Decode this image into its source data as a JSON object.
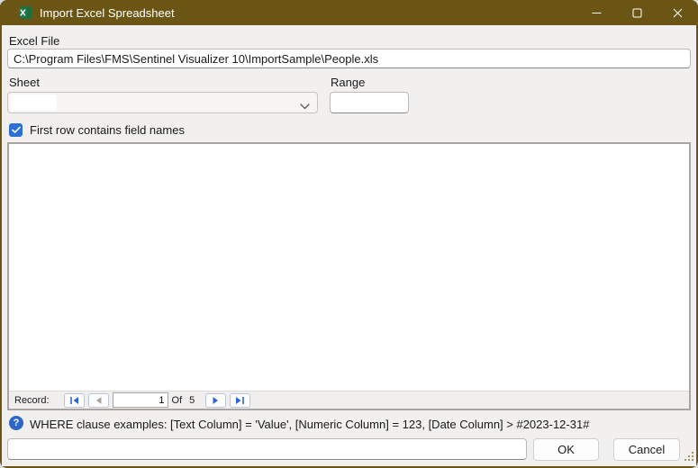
{
  "window": {
    "title": "Import Excel Spreadsheet"
  },
  "form": {
    "excel_file": {
      "label": "Excel File",
      "value": "C:\\Program Files\\FMS\\Sentinel Visualizer 10\\ImportSample\\People.xls"
    },
    "sheet": {
      "label": "Sheet",
      "value": ""
    },
    "range": {
      "label": "Range",
      "value": ""
    },
    "first_row_checkbox": {
      "label": "First row contains field names",
      "checked": true
    }
  },
  "record_nav": {
    "label": "Record:",
    "current": "1",
    "of": "Of",
    "total": "5"
  },
  "help": {
    "glyph": "?",
    "text": "WHERE clause examples: [Text Column] = 'Value', [Numeric Column] = 123, [Date Column] > #2023-12-31#"
  },
  "where_input": {
    "value": ""
  },
  "actions": {
    "ok": "OK",
    "cancel": "Cancel"
  },
  "colors": {
    "titlebar": "#6b5514",
    "dialog_bg": "#f1f0ef",
    "accent_blue": "#2d6fd3",
    "nav_arrow_blue": "#2b63d9",
    "excel_green_dark": "#1d6f42",
    "excel_green_light": "#2f9e63"
  }
}
